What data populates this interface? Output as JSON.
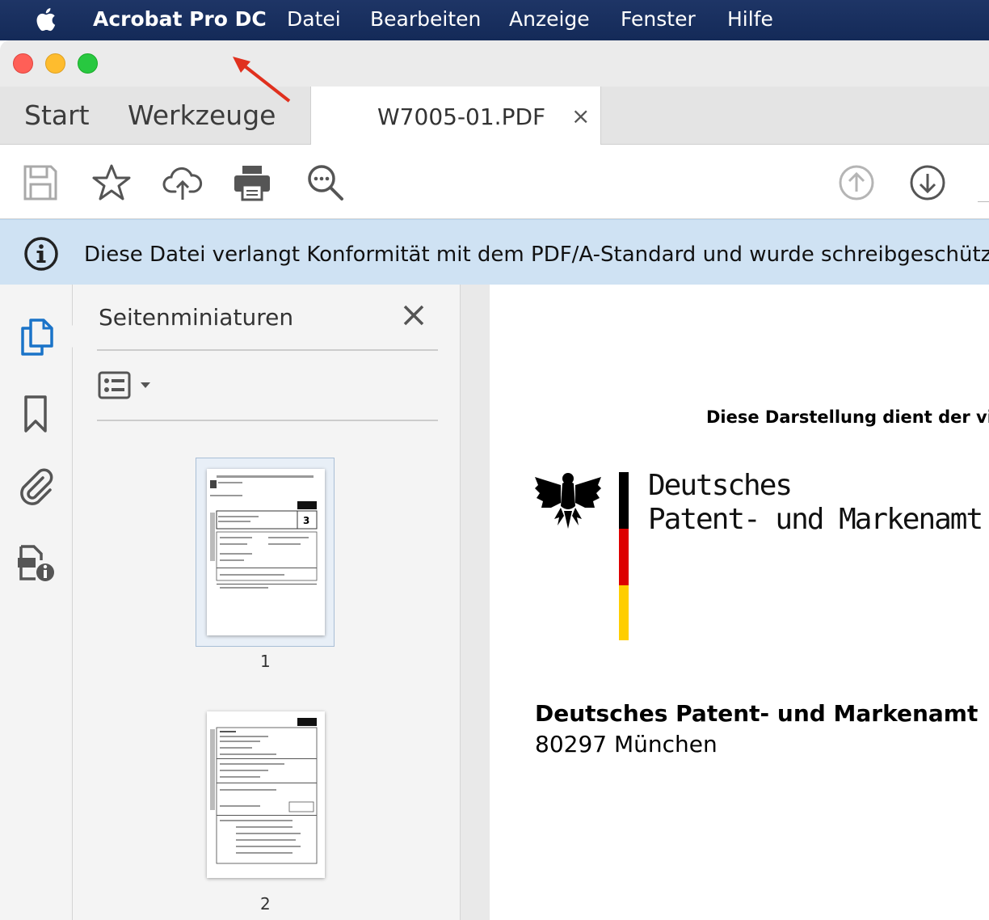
{
  "menubar": {
    "app_name": "Acrobat Pro DC",
    "items": [
      "Datei",
      "Bearbeiten",
      "Anzeige",
      "Fenster",
      "Hilfe"
    ]
  },
  "tabs": {
    "start": "Start",
    "tools": "Werkzeuge",
    "document": "W7005-01.PDF",
    "close_glyph": "×"
  },
  "toolbar": {
    "icons": [
      "save-icon",
      "star-icon",
      "cloud-upload-icon",
      "print-icon",
      "search-icon",
      "page-up-icon",
      "page-down-icon"
    ]
  },
  "banner": {
    "text": "Diese Datei verlangt Konformität mit dem PDF/A-Standard und wurde schreibgeschützt ge"
  },
  "rail": {
    "icons": [
      "page-thumbnails-icon",
      "bookmark-icon",
      "attachment-icon",
      "document-properties-icon"
    ]
  },
  "panel": {
    "title": "Seitenminiaturen",
    "thumbnails": [
      {
        "page_label": "1",
        "selected": true
      },
      {
        "page_label": "2",
        "selected": false
      }
    ]
  },
  "document": {
    "top_line": "Diese Darstellung dient der visu",
    "logo_line1": "Deutsches",
    "logo_line2": "Patent- und Markenamt",
    "address_name": "Deutsches Patent- und Markenamt",
    "address_city": "80297 München"
  },
  "colors": {
    "menubar": "#162d5c",
    "banner": "#cfe2f3",
    "accent_blue": "#1a73c8",
    "arrow_red": "#e0301e",
    "flag_black": "#000000",
    "flag_red": "#dd0000",
    "flag_gold": "#ffce00"
  }
}
